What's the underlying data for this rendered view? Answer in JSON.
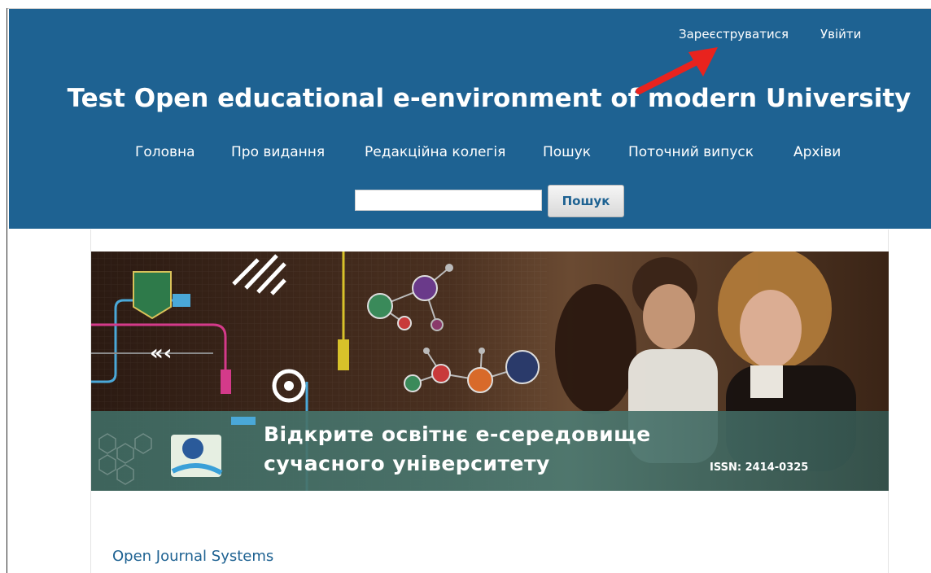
{
  "user_nav": {
    "register": "Зареєструватися",
    "login": "Увійти"
  },
  "site": {
    "title": "Test Open educational e-environment of modern University"
  },
  "main_nav": [
    "Головна",
    "Про видання",
    "Редакційна колегія",
    "Пошук",
    "Поточний випуск",
    "Архіви"
  ],
  "search": {
    "button_label": "Пошук",
    "value": ""
  },
  "banner": {
    "line1": "Відкрите освітнє е-середовище",
    "line2": "сучасного університету",
    "issn": "ISSN: 2414-0325"
  },
  "footer": {
    "ojs_link": "Open Journal Systems"
  },
  "colors": {
    "header_bg": "#1e6292",
    "link": "#1e6292",
    "arrow": "#e8231e"
  }
}
